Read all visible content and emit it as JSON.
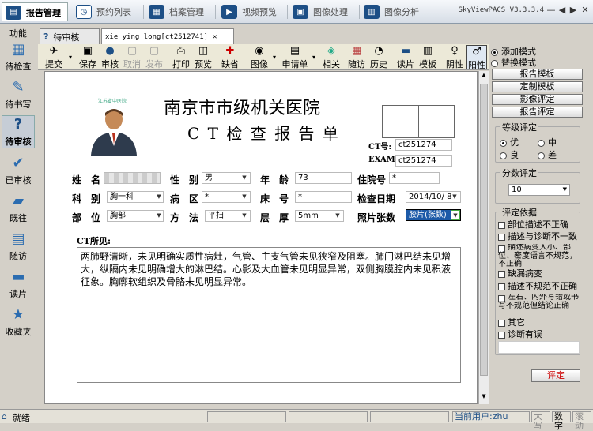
{
  "app": {
    "title": "SkyViewPACS V3.3.3.4",
    "controls": [
      "—",
      "◀",
      "▶",
      "✕"
    ]
  },
  "top_tabs": [
    {
      "label": "报告管理",
      "icon": "report-icon",
      "active": true
    },
    {
      "label": "预约列表",
      "icon": "clock-icon"
    },
    {
      "label": "档案管理",
      "icon": "archive-icon"
    },
    {
      "label": "视频预览",
      "icon": "video-icon"
    },
    {
      "label": "图像处理",
      "icon": "image-icon"
    },
    {
      "label": "图像分析",
      "icon": "chart-icon"
    }
  ],
  "sidebar": {
    "header": "功能",
    "items": [
      {
        "label": "待检查",
        "icon": "grid-icon"
      },
      {
        "label": "待书写",
        "icon": "pen-icon"
      },
      {
        "label": "待审核",
        "icon": "question-icon",
        "active": true
      },
      {
        "label": "已审核",
        "icon": "check-icon"
      },
      {
        "label": "既往",
        "icon": "folder-icon"
      },
      {
        "label": "随访",
        "icon": "calendar-icon"
      },
      {
        "label": "读片",
        "icon": "chat-icon"
      },
      {
        "label": "收藏夹",
        "icon": "star-icon"
      }
    ]
  },
  "doc_tabs": [
    {
      "label": "待审核",
      "icon": "help-icon"
    },
    {
      "label": "xie ying long[ct2512741]",
      "close": "✕",
      "active": true
    }
  ],
  "toolbar": [
    {
      "label": "提交",
      "icon": "submit-icon",
      "dropdown": true
    },
    {
      "label": "保存",
      "icon": "save-icon"
    },
    {
      "label": "审核",
      "icon": "audit-icon"
    },
    {
      "label": "取消",
      "icon": "cancel-icon",
      "disabled": true
    },
    {
      "label": "发布",
      "icon": "publish-icon",
      "disabled": true
    },
    {
      "label": "打印",
      "icon": "print-icon"
    },
    {
      "label": "预览",
      "icon": "preview-icon"
    },
    {
      "label": "缺省",
      "icon": "default-icon"
    },
    {
      "label": "图像",
      "icon": "images-icon",
      "dropdown": true
    },
    {
      "label": "申请单",
      "icon": "form-icon",
      "dropdown": true
    },
    {
      "label": "相关",
      "icon": "related-icon"
    },
    {
      "label": "随访",
      "icon": "followup-icon"
    },
    {
      "label": "历史",
      "icon": "history-icon"
    },
    {
      "label": "读片",
      "icon": "read-icon"
    },
    {
      "label": "模板",
      "icon": "template-icon"
    },
    {
      "label": "阴性",
      "icon": "female-icon"
    },
    {
      "label": "阳性",
      "icon": "male-icon",
      "active": true
    }
  ],
  "modes": {
    "add": "添加模式",
    "replace": "替换模式",
    "add_selected": true
  },
  "side_buttons": [
    "报告模板",
    "定制模板",
    "影像评定",
    "报告评定"
  ],
  "grade": {
    "title": "等级评定",
    "options": [
      "优",
      "中",
      "良",
      "差"
    ],
    "selected": "优"
  },
  "score": {
    "title": "分数评定",
    "value": "10"
  },
  "criteria": {
    "title": "评定依据",
    "items": [
      "部位描述不正确",
      "描述与诊断不一致",
      "描述病变大小、部位、密度语言不规范，不正确",
      "缺漏病变",
      "描述不规范不正确",
      "左右、内外写错或书写不规范但结论正确",
      "其它",
      "诊断有误"
    ],
    "confirm": "评定"
  },
  "report": {
    "hospital": "南京市市级机关医院",
    "title": "C T 检 查 报 告 单",
    "logo_text": "江苏省中医院",
    "ct_no_label": "CT号:",
    "ct_no": "ct251274",
    "exam_label": "EXAM:",
    "exam": "ct251274",
    "fields": {
      "name_label": "姓　名",
      "name": "",
      "sex_label": "性　别",
      "sex": "男",
      "age_label": "年　龄",
      "age": "73",
      "inpatient_label": "住院号",
      "inpatient": "*",
      "dept_label": "科　别",
      "dept": "胸一科",
      "ward_label": "病　区",
      "ward": "*",
      "bed_label": "床　号",
      "bed": "*",
      "date_label": "检查日期",
      "date": "2014/10/ 8",
      "part_label": "部　位",
      "part": "胸部",
      "method_label": "方　法",
      "method": "平扫",
      "layer_label": "层　厚",
      "layer": "5mm",
      "films_label": "照片张数",
      "films": "胶片(张数)"
    },
    "findings_label": "CT所见:",
    "findings": "两肺野清晰，未见明确实质性病灶，气管、主支气管未见狭窄及阻塞。肺门淋巴结未见增大，纵隔内未见明确增大的淋巴结。心影及大血管未见明显异常，双侧胸膜腔内未见积液征象。胸廓软组织及骨骼未见明显异常。"
  },
  "status": {
    "ready": "就绪",
    "user_label": "当前用户:",
    "user": "zhu",
    "caps": "大写",
    "num": "数字",
    "scroll": "滚动"
  }
}
